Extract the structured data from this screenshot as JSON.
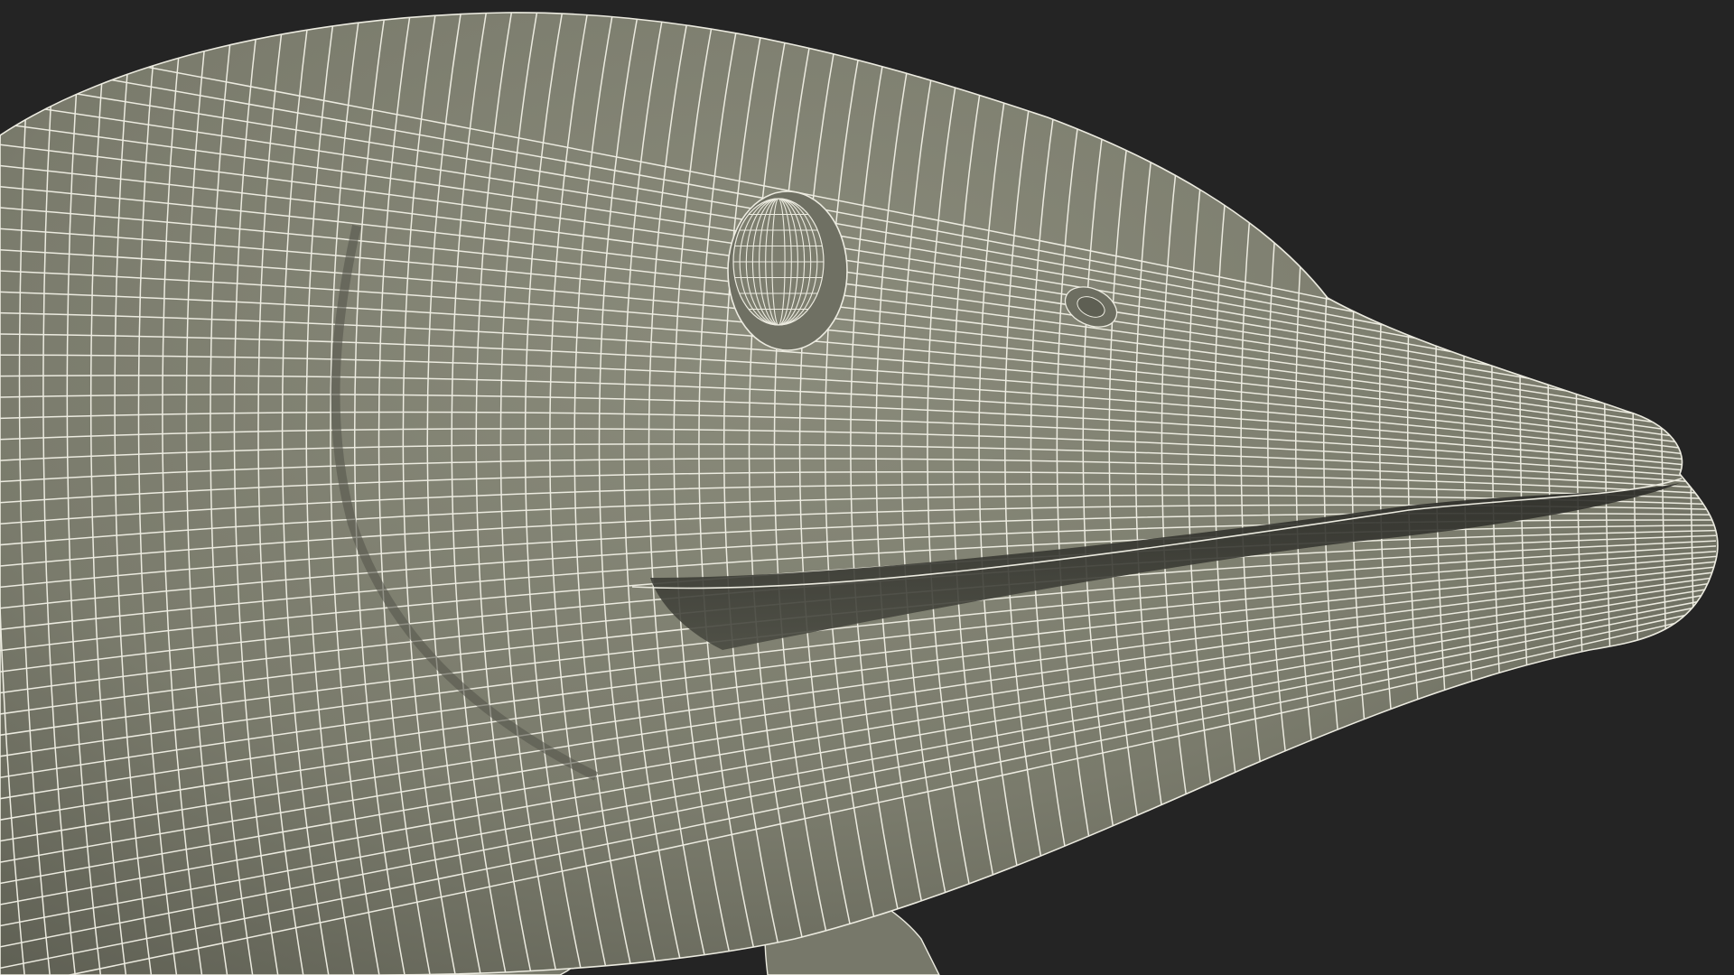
{
  "scene": {
    "subject": "fish-head-wireframe-render",
    "colors": {
      "background": "#242424",
      "surface": "#7a7b6c",
      "surface_shadow": "#5e5f53",
      "surface_highlight": "#8a8b7b",
      "wire": "#ecebe0",
      "mouth_gap": "#2a2a26"
    }
  }
}
